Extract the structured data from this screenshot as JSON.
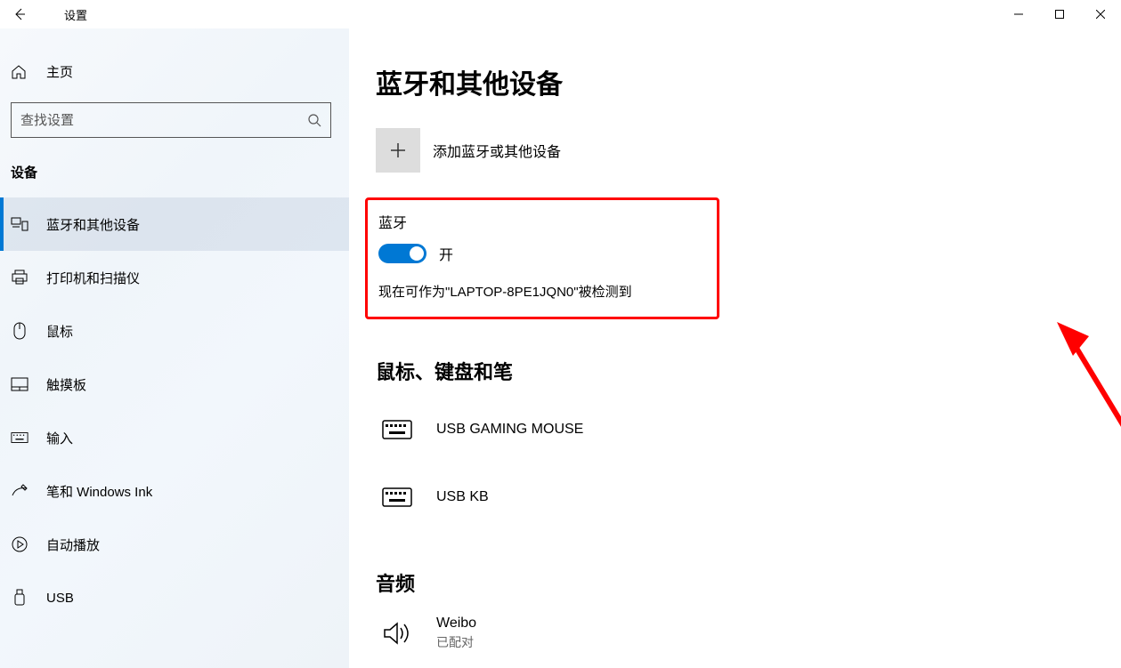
{
  "window": {
    "title": "设置"
  },
  "sidebar": {
    "home_label": "主页",
    "search_placeholder": "查找设置",
    "category_label": "设备",
    "items": [
      {
        "label": "蓝牙和其他设备",
        "icon": "devices-icon",
        "active": true
      },
      {
        "label": "打印机和扫描仪",
        "icon": "printer-icon",
        "active": false
      },
      {
        "label": "鼠标",
        "icon": "mouse-icon",
        "active": false
      },
      {
        "label": "触摸板",
        "icon": "touchpad-icon",
        "active": false
      },
      {
        "label": "输入",
        "icon": "keyboard-icon",
        "active": false
      },
      {
        "label": "笔和 Windows Ink",
        "icon": "pen-icon",
        "active": false
      },
      {
        "label": "自动播放",
        "icon": "autoplay-icon",
        "active": false
      },
      {
        "label": "USB",
        "icon": "usb-icon",
        "active": false
      }
    ]
  },
  "main": {
    "page_title": "蓝牙和其他设备",
    "add_device_label": "添加蓝牙或其他设备",
    "bluetooth": {
      "heading": "蓝牙",
      "toggle_state_label": "开",
      "status_text": "现在可作为\"LAPTOP-8PE1JQN0\"被检测到"
    },
    "section_mouse_keyboard": {
      "heading": "鼠标、键盘和笔",
      "devices": [
        {
          "name": "USB GAMING MOUSE",
          "icon": "keyboard-device-icon"
        },
        {
          "name": "USB KB",
          "icon": "keyboard-device-icon"
        }
      ]
    },
    "section_audio": {
      "heading": "音频",
      "devices": [
        {
          "name": "Weibo",
          "sub": "已配对",
          "icon": "speaker-icon"
        }
      ]
    }
  },
  "annotation": {
    "highlight_color": "#ff0000"
  }
}
